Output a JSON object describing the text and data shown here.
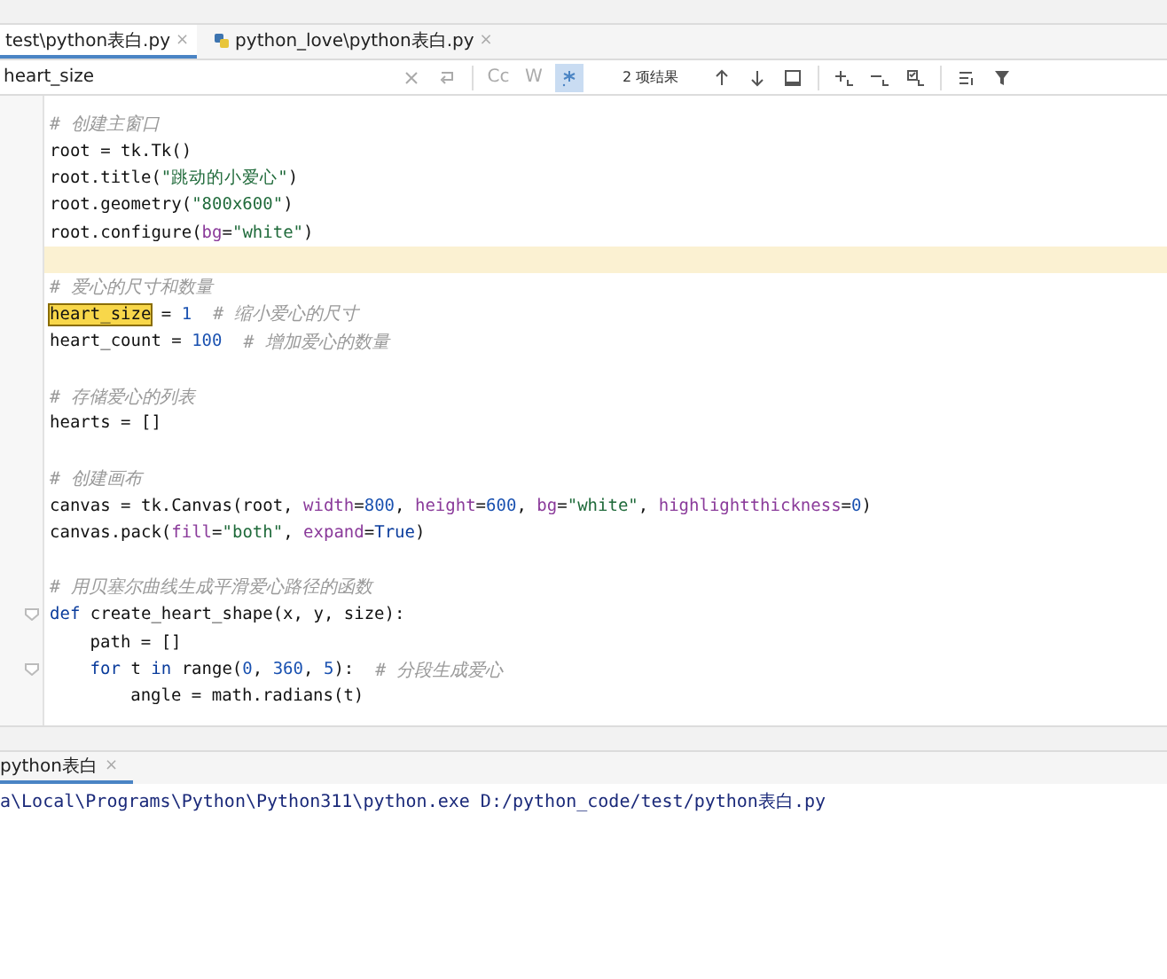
{
  "tabs": [
    {
      "label": "test\\python表白.py",
      "close": "×",
      "selected": true,
      "python_icon": false
    },
    {
      "label": "python_love\\python表白.py",
      "close": "×",
      "selected": false,
      "python_icon": true
    }
  ],
  "search": {
    "value": "heart_size",
    "options": [
      {
        "kind": "text",
        "label": "Cc",
        "selected": false
      },
      {
        "kind": "text",
        "label": "W",
        "selected": false
      },
      {
        "kind": "regex",
        "selected": true
      }
    ],
    "results": "2 项结果"
  },
  "code_lines": [
    {
      "current": false,
      "tokens": [
        {
          "kind": "comment",
          "text": "# 创建主窗口"
        }
      ]
    },
    {
      "current": false,
      "tokens": [
        {
          "kind": "plain",
          "text": "root = tk.Tk()"
        }
      ]
    },
    {
      "current": false,
      "tokens": [
        {
          "kind": "plain",
          "text": "root.title("
        },
        {
          "kind": "string",
          "text": "\"跳动的小爱心\""
        },
        {
          "kind": "plain",
          "text": ")"
        }
      ]
    },
    {
      "current": false,
      "tokens": [
        {
          "kind": "plain",
          "text": "root.geometry("
        },
        {
          "kind": "string",
          "text": "\"800x600\""
        },
        {
          "kind": "plain",
          "text": ")"
        }
      ]
    },
    {
      "current": false,
      "tokens": [
        {
          "kind": "plain",
          "text": "root.configure("
        },
        {
          "kind": "param",
          "text": "bg"
        },
        {
          "kind": "plain",
          "text": "="
        },
        {
          "kind": "string",
          "text": "\"white\""
        },
        {
          "kind": "plain",
          "text": ")"
        }
      ]
    },
    {
      "current": true
    },
    {
      "current": false,
      "tokens": [
        {
          "kind": "comment",
          "text": "# 爱心的尺寸和数量"
        }
      ]
    },
    {
      "current": false,
      "tokens": [
        {
          "kind": "match",
          "text": "heart_size"
        },
        {
          "kind": "plain",
          "text": " = "
        },
        {
          "kind": "number",
          "text": "1"
        },
        {
          "kind": "comment",
          "text": "  # 缩小爱心的尺寸"
        }
      ]
    },
    {
      "current": false,
      "tokens": [
        {
          "kind": "plain",
          "text": "heart_count = "
        },
        {
          "kind": "number",
          "text": "100"
        },
        {
          "kind": "comment",
          "text": "  # 增加爱心的数量"
        }
      ]
    },
    {
      "current": false
    },
    {
      "current": false,
      "tokens": [
        {
          "kind": "comment",
          "text": "# 存储爱心的列表"
        }
      ]
    },
    {
      "current": false,
      "tokens": [
        {
          "kind": "plain",
          "text": "hearts = []"
        }
      ]
    },
    {
      "current": false
    },
    {
      "current": false,
      "tokens": [
        {
          "kind": "comment",
          "text": "# 创建画布"
        }
      ]
    },
    {
      "current": false,
      "tokens": [
        {
          "kind": "plain",
          "text": "canvas = tk.Canvas(root, "
        },
        {
          "kind": "param",
          "text": "width"
        },
        {
          "kind": "plain",
          "text": "="
        },
        {
          "kind": "number",
          "text": "800"
        },
        {
          "kind": "plain",
          "text": ", "
        },
        {
          "kind": "param",
          "text": "height"
        },
        {
          "kind": "plain",
          "text": "="
        },
        {
          "kind": "number",
          "text": "600"
        },
        {
          "kind": "plain",
          "text": ", "
        },
        {
          "kind": "param",
          "text": "bg"
        },
        {
          "kind": "plain",
          "text": "="
        },
        {
          "kind": "string",
          "text": "\"white\""
        },
        {
          "kind": "plain",
          "text": ", "
        },
        {
          "kind": "param",
          "text": "highlightthickness"
        },
        {
          "kind": "plain",
          "text": "="
        },
        {
          "kind": "number",
          "text": "0"
        },
        {
          "kind": "plain",
          "text": ")"
        }
      ]
    },
    {
      "current": false,
      "tokens": [
        {
          "kind": "plain",
          "text": "canvas.pack("
        },
        {
          "kind": "param",
          "text": "fill"
        },
        {
          "kind": "plain",
          "text": "="
        },
        {
          "kind": "string",
          "text": "\"both\""
        },
        {
          "kind": "plain",
          "text": ", "
        },
        {
          "kind": "param",
          "text": "expand"
        },
        {
          "kind": "plain",
          "text": "="
        },
        {
          "kind": "keyword",
          "text": "True"
        },
        {
          "kind": "plain",
          "text": ")"
        }
      ]
    },
    {
      "current": false
    },
    {
      "current": false,
      "tokens": [
        {
          "kind": "comment",
          "text": "# 用贝塞尔曲线生成平滑爱心路径的函数"
        }
      ]
    },
    {
      "current": false,
      "tokens": [
        {
          "kind": "keyword",
          "text": "def"
        },
        {
          "kind": "plain",
          "text": " create_heart_shape(x, y, size):"
        }
      ],
      "children": [
        {
          "current": false,
          "tokens": [
            {
              "kind": "plain",
              "text": "path = []"
            }
          ]
        },
        {
          "current": false,
          "tokens": [
            {
              "kind": "keyword",
              "text": "for"
            },
            {
              "kind": "plain",
              "text": " t "
            },
            {
              "kind": "keyword",
              "text": "in"
            },
            {
              "kind": "plain",
              "text": " range("
            },
            {
              "kind": "number",
              "text": "0"
            },
            {
              "kind": "plain",
              "text": ", "
            },
            {
              "kind": "number",
              "text": "360"
            },
            {
              "kind": "plain",
              "text": ", "
            },
            {
              "kind": "number",
              "text": "5"
            },
            {
              "kind": "plain",
              "text": "):"
            },
            {
              "kind": "comment",
              "text": "  # 分段生成爱心"
            }
          ],
          "children": [
            {
              "current": false,
              "tokens": [
                {
                  "kind": "plain",
                  "text": "angle = math.radians(t)"
                }
              ]
            }
          ]
        }
      ]
    }
  ],
  "run_tab": {
    "label": "python表白",
    "close": "×",
    "selected": true
  },
  "output": "a\\Local\\Programs\\Python\\Python311\\python.exe D:/python_code/test/python表白.py"
}
